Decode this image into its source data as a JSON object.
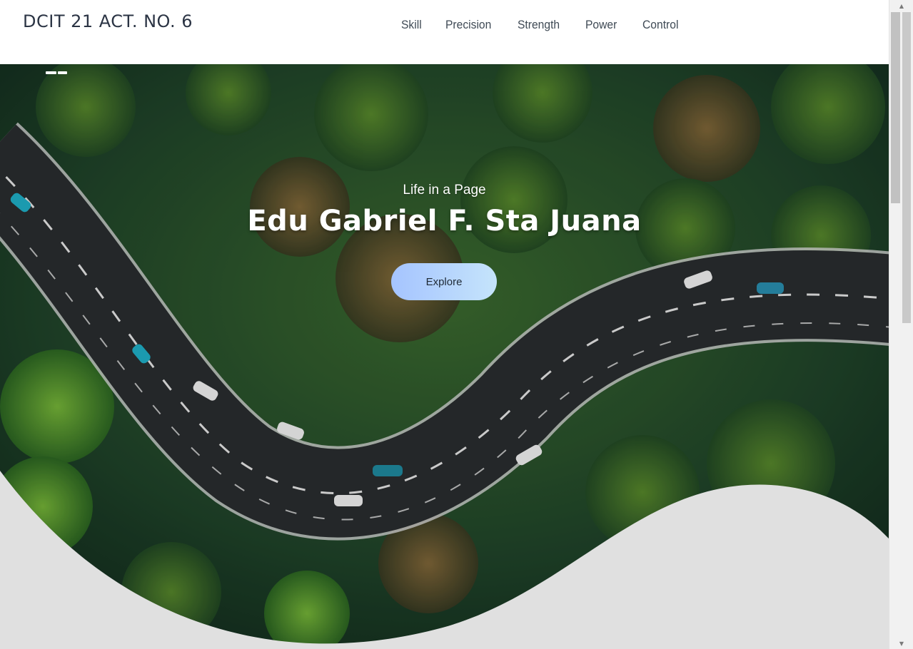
{
  "brand": "DCIT 21 ACT. NO. 6",
  "nav": [
    "Skill",
    "Precision",
    "Strength",
    "Power",
    "Control"
  ],
  "hero": {
    "subtitle": "Life in a Page",
    "title": "Edu Gabriel F. Sta Juana",
    "button_label": "Explore"
  },
  "colors": {
    "forest": "#1f4a2a",
    "road": "#2a2d2f",
    "button_start": "#a5c4ff",
    "button_end": "#c5e4fb"
  },
  "icons": {
    "menu": "menu-icon",
    "scroll_up": "arrow-up-icon",
    "scroll_down": "arrow-down-icon"
  }
}
